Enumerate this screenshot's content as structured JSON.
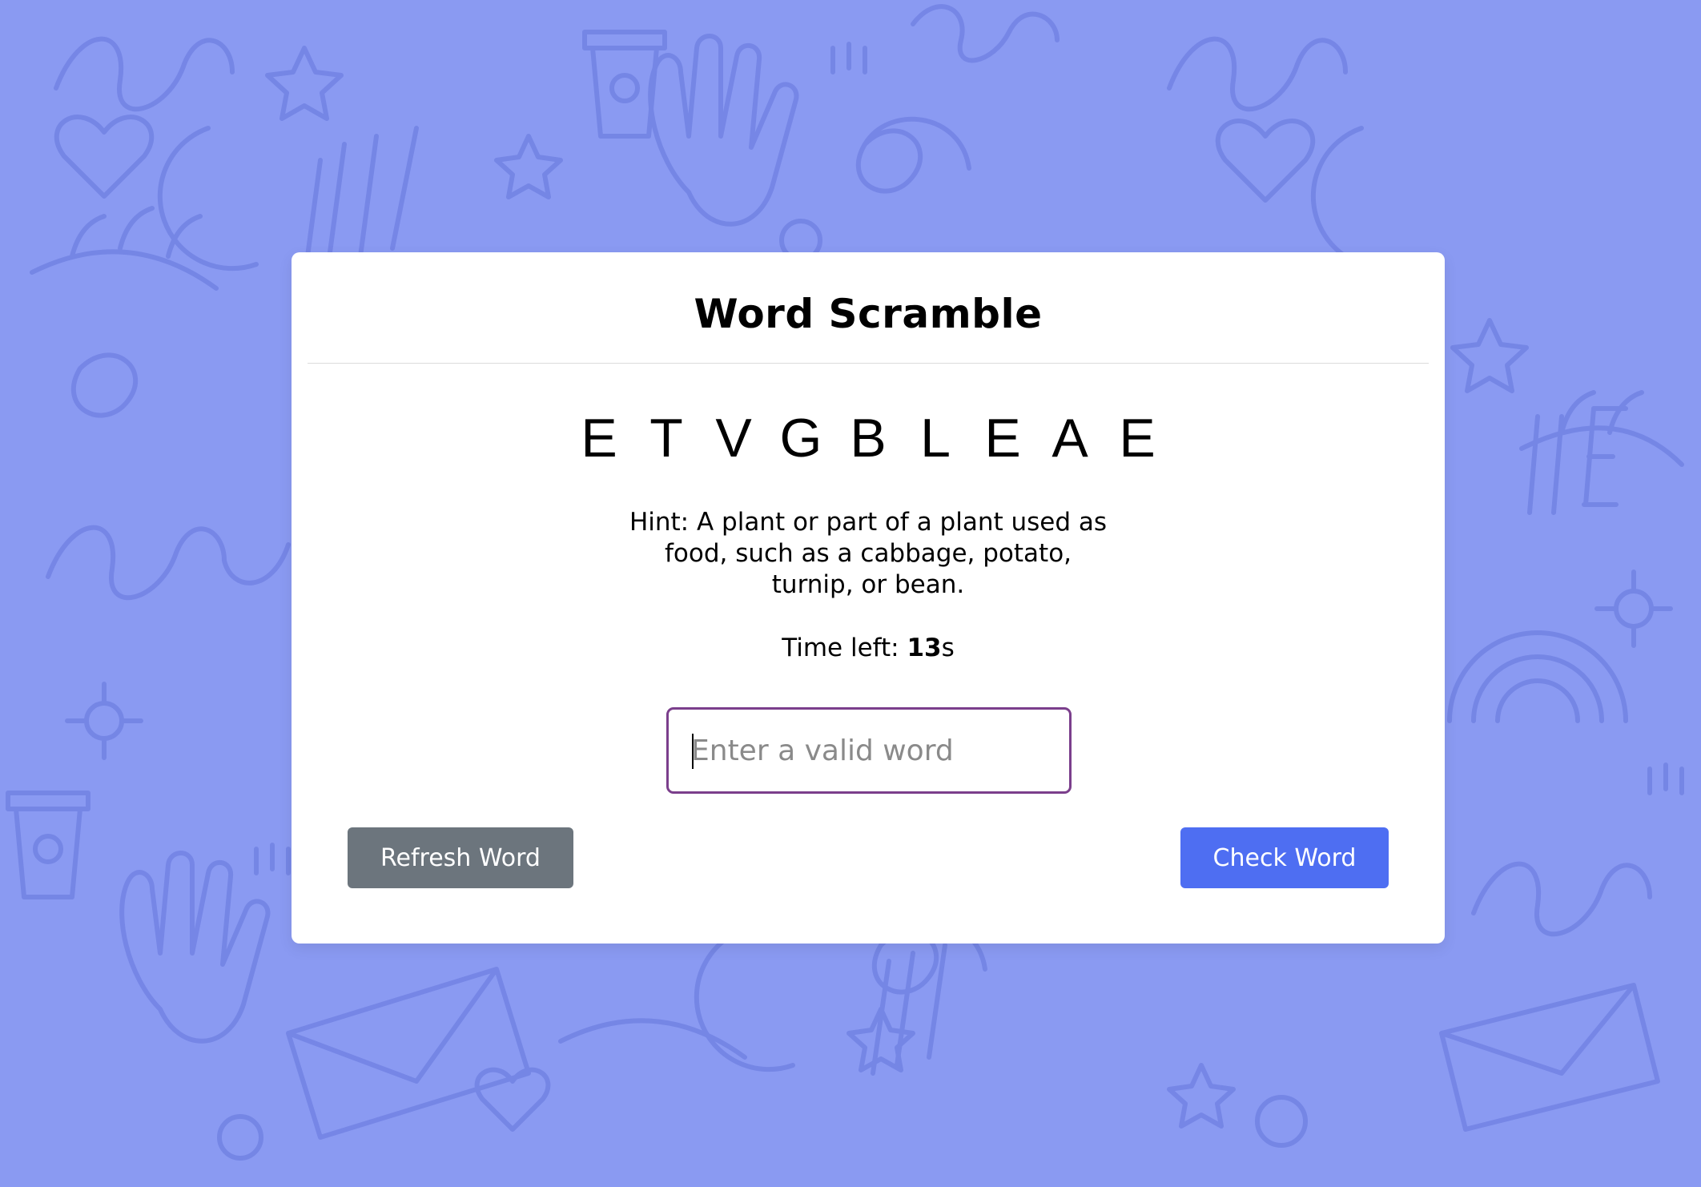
{
  "game": {
    "title": "Word Scramble",
    "letters": [
      "E",
      "T",
      "V",
      "G",
      "B",
      "L",
      "E",
      "A",
      "E"
    ],
    "hint": "Hint: A plant or part of a plant used as food, such as a cabbage, potato, turnip, or bean.",
    "time_label": "Time left: ",
    "time_value": "13",
    "time_unit": "s",
    "input_placeholder": "Enter a valid word",
    "input_value": "",
    "refresh_label": "Refresh Word",
    "check_label": "Check Word"
  },
  "colors": {
    "background": "#8a9af2",
    "doodle": "#6f80e0",
    "card": "#ffffff",
    "input_border": "#7b3f8c",
    "refresh_button": "#6c757d",
    "check_button": "#4e6ef2"
  },
  "icons": {
    "background_pattern": "doodle-pattern"
  }
}
